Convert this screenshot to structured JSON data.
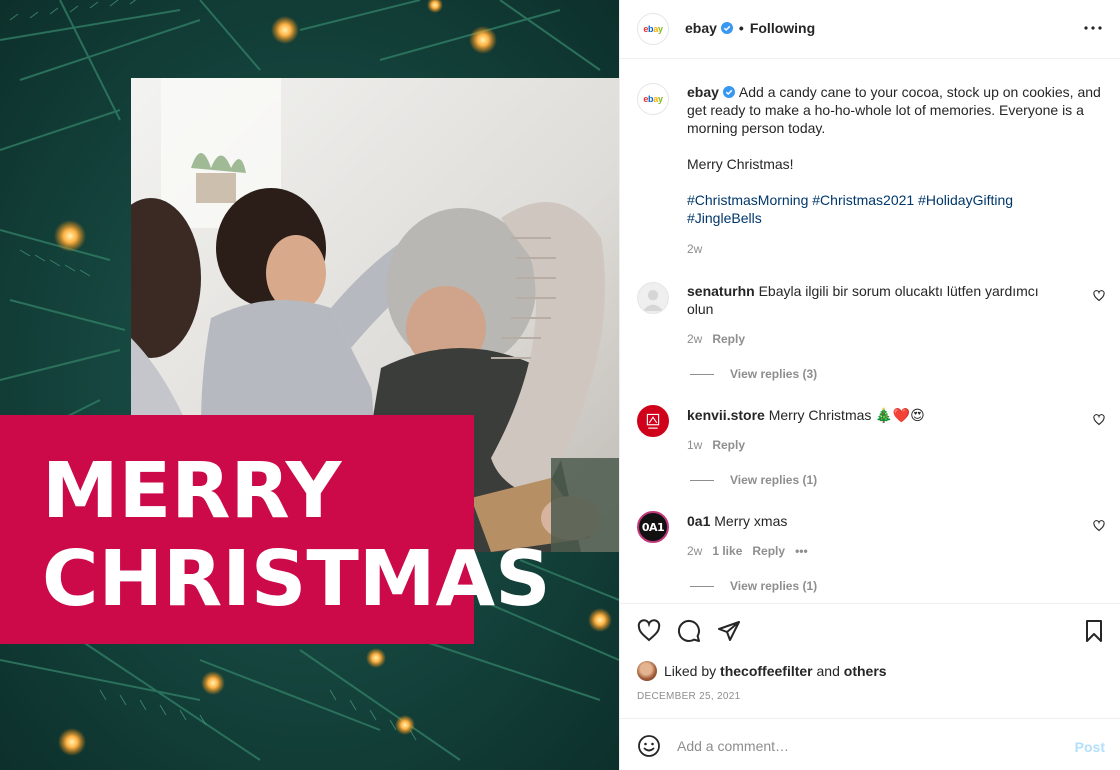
{
  "media": {
    "banner_line1": "MERRY",
    "banner_line2": "CHRISTMAS"
  },
  "header": {
    "username": "ebay",
    "separator": "•",
    "follow_status": "Following"
  },
  "caption": {
    "username": "ebay",
    "text": "Add a candy cane to your cocoa, stock up on cookies, and get ready to make a ho-ho-whole lot of memories. Everyone is a morning person today.",
    "line2": "Merry Christmas!",
    "hashtags": [
      "#ChristmasMorning",
      "#Christmas2021",
      "#HolidayGifting",
      "#JingleBells"
    ],
    "time": "2w"
  },
  "comments": [
    {
      "username": "senaturhn",
      "text": "Ebayla ilgili bir sorum olucaktı lütfen yardımcı olun",
      "time": "2w",
      "likes": "",
      "reply": "Reply",
      "view_replies": "View replies (3)"
    },
    {
      "username": "kenvii.store",
      "text": "Merry Christmas 🎄❤️😍",
      "time": "1w",
      "likes": "",
      "reply": "Reply",
      "view_replies": "View replies (1)"
    },
    {
      "username": "0a1",
      "text": "Merry xmas",
      "time": "2w",
      "likes": "1 like",
      "reply": "Reply",
      "more": "•••",
      "view_replies": "View replies (1)"
    }
  ],
  "actions": {
    "liked_prefix": "Liked by",
    "liked_user": "thecoffeefilter",
    "liked_and": "and",
    "liked_others": "others",
    "date": "DECEMBER 25, 2021"
  },
  "comment_box": {
    "placeholder": "Add a comment…",
    "post_label": "Post"
  },
  "colors": {
    "banner": "#cc0a4a",
    "verified": "#3897f0",
    "link": "#00376b",
    "post_disabled": "#b2dffc"
  },
  "icons": [
    "heart-icon",
    "comment-icon",
    "share-icon",
    "bookmark-icon",
    "more-icon",
    "emoji-icon",
    "verified-icon"
  ]
}
